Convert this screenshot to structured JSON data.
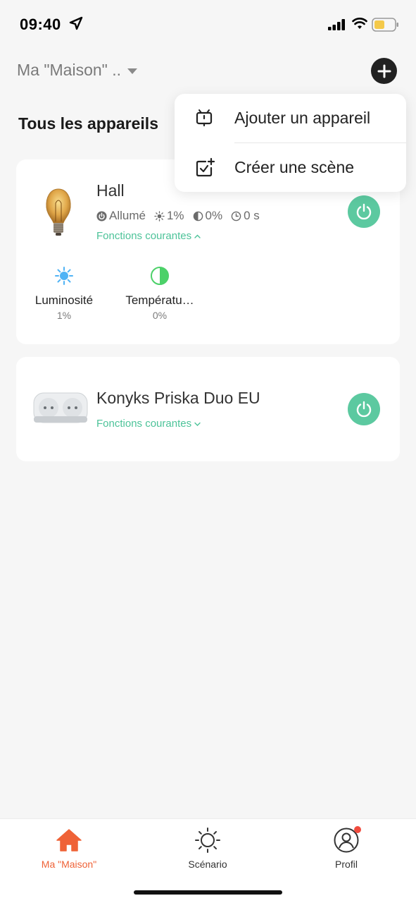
{
  "status_bar": {
    "time": "09:40"
  },
  "header": {
    "home_name": "Ma \"Maison\" .."
  },
  "section": {
    "title": "Tous les appareils"
  },
  "devices": [
    {
      "name": "Hall",
      "status": {
        "power": "Allumé",
        "brightness": "1%",
        "temperature": "0%",
        "timer": "0 s"
      },
      "quick_functions_label": "Fonctions courantes",
      "functions": [
        {
          "label": "Luminosité",
          "value": "1%"
        },
        {
          "label": "Températu…",
          "value": "0%"
        }
      ]
    },
    {
      "name": "Konyks Priska Duo EU",
      "quick_functions_label": "Fonctions courantes"
    }
  ],
  "menu": {
    "items": [
      {
        "label": "Ajouter un appareil",
        "icon": "device-add-icon"
      },
      {
        "label": "Créer une scène",
        "icon": "scene-add-icon"
      }
    ]
  },
  "tabs": [
    {
      "label": "Ma \"Maison\"",
      "icon": "home-icon",
      "active": true
    },
    {
      "label": "Scénario",
      "icon": "sun-icon",
      "active": false
    },
    {
      "label": "Profil",
      "icon": "profile-icon",
      "active": false,
      "notification": true
    }
  ],
  "colors": {
    "accent": "#5cc9a0",
    "active_tab": "#ef6237",
    "brightness_icon": "#4fb3f5",
    "temperature_icon": "#4cd169",
    "notification": "#f04b3e"
  }
}
